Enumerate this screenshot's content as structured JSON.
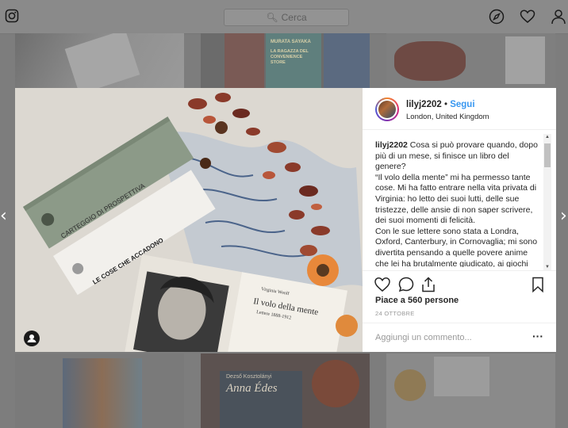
{
  "topbar": {
    "search_placeholder": "Cerca"
  },
  "post": {
    "username": "lilyj2202",
    "follow_label": "Segui",
    "separator": "•",
    "location": "London, United Kingdom",
    "caption_user": "lilyj2202",
    "caption_text": "Cosa si può provare quando, dopo più di un mese, si finisce un libro del genere?\n“Il volo della mente” mi ha permesso tante cose. Mi ha fatto entrare nella vita privata di Virginia: ho letto dei suoi lutti, delle sue tristezze, delle ansie di non saper scrivere, dei suoi momenti di felicità.\nCon le sue lettere sono stata a Londra, Oxford, Canterbury, in Cornovaglia; mi sono divertita pensando a quelle povere anime che lei ha brutalmente giudicato, ai giochi che faceva con i fratelli; mi sono",
    "likes": "Piace a 560 persone",
    "date": "24 OTTOBRE",
    "comment_placeholder": "Aggiungi un commento...",
    "more_label": "···"
  },
  "photo": {
    "book1_spine": "CARTEGGIO DI PROSPETTIVA",
    "book2_spine": "LE COSE CHE ACCADONO",
    "book3_author": "Virginia Woolf",
    "book3_title": "Il volo della mente",
    "book3_subtitle": "Lettere 1888-1912"
  },
  "background": {
    "tile_book_author": "MURATA SAYAKA",
    "tile_book_title": "LA RAGAZZA DEL CONVENIENCE STORE",
    "tile_book2_author": "Dezső Kosztolányi",
    "tile_book2_title": "Anna Édes"
  },
  "colors": {
    "link": "#3897f0",
    "text": "#262626",
    "muted": "#999999"
  }
}
